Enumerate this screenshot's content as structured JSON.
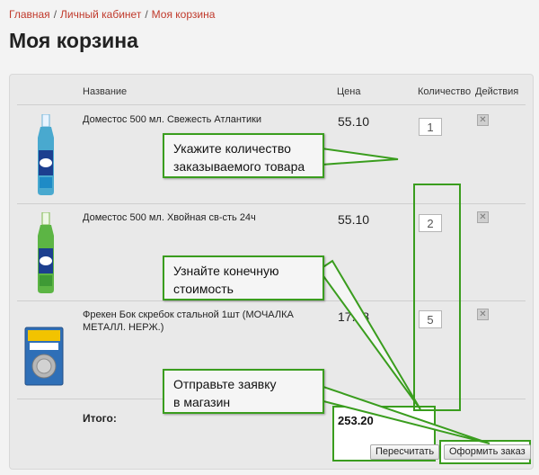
{
  "breadcrumb": {
    "home": "Главная",
    "cabinet": "Личный кабинет",
    "current": "Моя корзина",
    "separator": "/"
  },
  "page_title": "Моя корзина",
  "table": {
    "headers": {
      "name": "Название",
      "price": "Цена",
      "quantity": "Количество",
      "actions": "Действия"
    },
    "rows": [
      {
        "name": "Доместос 500 мл. Свежесть Атлантики",
        "price": "55.10",
        "quantity": "1"
      },
      {
        "name": "Доместос 500 мл. Хвойная св-сть 24ч",
        "price": "55.10",
        "quantity": "2"
      },
      {
        "name": "Фрекен Бок скребок стальной 1шт (МОЧАЛКА МЕТАЛЛ. НЕРЖ.)",
        "price": "17.58",
        "quantity": "5"
      }
    ],
    "total_label": "Итого:",
    "total_value": "253.20"
  },
  "buttons": {
    "recalculate": "Пересчитать",
    "checkout": "Оформить заказ"
  },
  "callouts": {
    "quantity": [
      "Укажите количество",
      "заказываемого товара"
    ],
    "total": [
      "Узнайте конечную",
      "стоимость"
    ],
    "order": [
      "Отправьте заявку",
      "в магазин"
    ]
  },
  "colors": {
    "accent": "#3a9d1e",
    "link": "#c0392b",
    "background": "#f3f3f3"
  },
  "icons": {
    "delete": "close-icon"
  }
}
